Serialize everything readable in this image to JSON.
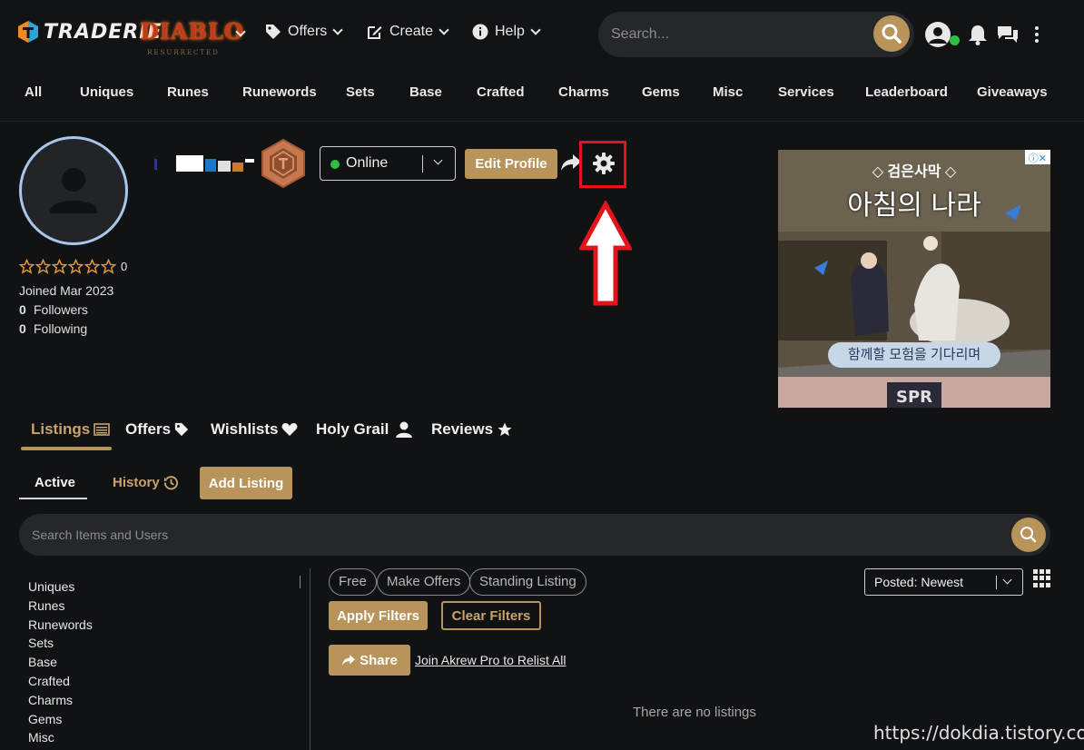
{
  "brand": {
    "name": "TRADERIE",
    "game_title": "DIABLO",
    "game_subtitle": "RESURRECTED"
  },
  "nav": {
    "offers": "Offers",
    "create": "Create",
    "help": "Help",
    "search_placeholder": "Search..."
  },
  "categories": [
    "All",
    "Uniques",
    "Runes",
    "Runewords",
    "Sets",
    "Base",
    "Crafted",
    "Charms",
    "Gems",
    "Misc",
    "Services",
    "Leaderboard",
    "Giveaways"
  ],
  "profile": {
    "rating_count": "0",
    "joined": "Joined Mar 2023",
    "followers_count": "0",
    "followers_label": "Followers",
    "following_count": "0",
    "following_label": "Following",
    "status": "Online",
    "edit_profile": "Edit Profile"
  },
  "ad": {
    "badge": "ⓘ✕",
    "title1": "◇ 검은사막 ◇",
    "title2": "아침의 나라",
    "ribbon": "함께할 모험을 기다리며"
  },
  "tabs": [
    "Listings",
    "Offers",
    "Wishlists",
    "Holy Grail",
    "Reviews"
  ],
  "subtabs": {
    "active": "Active",
    "history": "History",
    "add_listing": "Add Listing"
  },
  "listing_search": {
    "placeholder": "Search Items and Users"
  },
  "sidebar_categories": [
    "Uniques",
    "Runes",
    "Runewords",
    "Sets",
    "Base",
    "Crafted",
    "Charms",
    "Gems",
    "Misc"
  ],
  "filters": {
    "pills": [
      "Free",
      "Make Offers",
      "Standing Listing"
    ],
    "sort": "Posted: Newest",
    "apply": "Apply Filters",
    "clear": "Clear Filters",
    "share": "Share",
    "relist": "Join Akrew Pro to Relist All",
    "empty": "There are no listings"
  },
  "watermark": "https://dokdia.tistory.com",
  "colors": {
    "accent_gold": "#b8935a",
    "online_green": "#2fbf3f",
    "highlight_red": "#e5141b",
    "avatar_ring": "#a6c7e8"
  }
}
